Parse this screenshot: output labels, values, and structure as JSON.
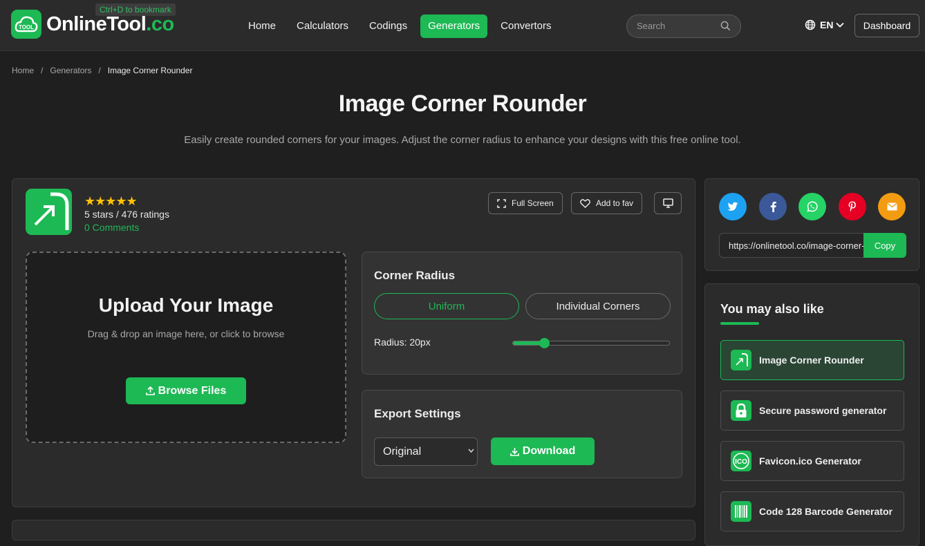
{
  "header": {
    "logo_badge": "TOOL",
    "logo_main": "OnlineTool",
    "logo_tld": ".co",
    "bookmark_hint": "Ctrl+D to bookmark",
    "nav": [
      {
        "label": "Home",
        "active": false
      },
      {
        "label": "Calculators",
        "active": false
      },
      {
        "label": "Codings",
        "active": false
      },
      {
        "label": "Generators",
        "active": true
      },
      {
        "label": "Convertors",
        "active": false
      }
    ],
    "search_placeholder": "Search",
    "language": "EN",
    "dashboard_label": "Dashboard"
  },
  "breadcrumb": {
    "items": [
      "Home",
      "Generators",
      "Image Corner Rounder"
    ],
    "separator": "/"
  },
  "page": {
    "title": "Image Corner Rounder",
    "description": "Easily create rounded corners for your images. Adjust the corner radius to enhance your designs with this free online tool."
  },
  "tool": {
    "stars": "★★★★★",
    "rating_text": "5 stars / 476 ratings",
    "comments": "0 Comments",
    "fullscreen_label": "Full Screen",
    "fav_label": "Add to fav"
  },
  "upload": {
    "title": "Upload Your Image",
    "hint": "Drag & drop an image here, or click to browse",
    "browse_label": "Browse Files"
  },
  "corner_radius": {
    "title": "Corner Radius",
    "modes": [
      "Uniform",
      "Individual Corners"
    ],
    "active_mode": "Uniform",
    "radius_label": "Radius: 20px",
    "slider_fraction": 0.2
  },
  "export": {
    "title": "Export Settings",
    "format_selected": "Original",
    "download_label": "Download"
  },
  "share": {
    "networks": [
      {
        "name": "twitter-icon",
        "color": "#1da1f2"
      },
      {
        "name": "facebook-icon",
        "color": "#3b5998"
      },
      {
        "name": "whatsapp-icon",
        "color": "#25d366"
      },
      {
        "name": "pinterest-icon",
        "color": "#e60023"
      },
      {
        "name": "email-icon",
        "color": "#f39c12"
      }
    ],
    "url": "https://onlinetool.co/image-corner-rounder",
    "copy_label": "Copy"
  },
  "also_like": {
    "title": "You may also like",
    "items": [
      {
        "label": "Image Corner Rounder",
        "icon": "corner-arrow-icon",
        "selected": true
      },
      {
        "label": "Secure password generator",
        "icon": "lock-icon",
        "selected": false
      },
      {
        "label": "Favicon.ico Generator",
        "icon": "ico-icon",
        "selected": false
      },
      {
        "label": "Code 128 Barcode Generator",
        "icon": "barcode-icon",
        "selected": false
      }
    ]
  },
  "colors": {
    "accent": "#1db954",
    "background": "#1f1f1f",
    "panel": "#2b2b2b",
    "star": "#ffc107"
  }
}
